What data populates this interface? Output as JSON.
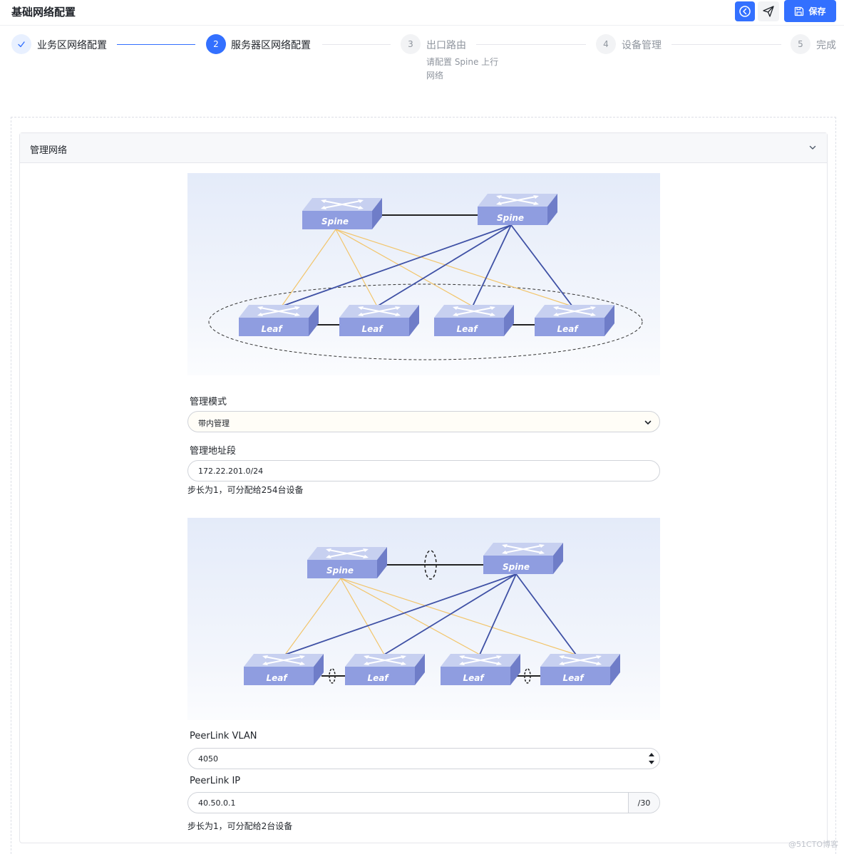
{
  "header": {
    "title": "基础网络配置",
    "save_label": "保存",
    "back_icon": "circle-arrow-left-icon",
    "send_icon": "send-icon",
    "save_icon": "floppy-disk-icon",
    "accent": "#3370ff"
  },
  "steps": [
    {
      "index": "✓",
      "label": "业务区网络配置",
      "status": "done"
    },
    {
      "index": "2",
      "label": "服务器区网络配置",
      "status": "active"
    },
    {
      "index": "3",
      "label": "出口路由",
      "status": "wait",
      "desc": "请配置 Spine 上行网络"
    },
    {
      "index": "4",
      "label": "设备管理",
      "status": "wait"
    },
    {
      "index": "5",
      "label": "完成",
      "status": "wait"
    }
  ],
  "panel": {
    "title": "管理网络",
    "chevron_icon": "chevron-down-icon"
  },
  "diagram1": {
    "spines": [
      "Spine",
      "Spine"
    ],
    "leaves": [
      "Leaf",
      "Leaf",
      "Leaf",
      "Leaf"
    ]
  },
  "mgmt_mode": {
    "label": "管理模式",
    "value": "带内管理"
  },
  "mgmt_addr": {
    "label": "管理地址段",
    "value": "172.22.201.0/24",
    "hint": "步长为1，可分配给254台设备"
  },
  "diagram2": {
    "spines": [
      "Spine",
      "Spine"
    ],
    "leaves": [
      "Leaf",
      "Leaf",
      "Leaf",
      "Leaf"
    ]
  },
  "peerlink_vlan": {
    "label": "PeerLink VLAN",
    "value": "4050"
  },
  "peerlink_ip": {
    "label": "PeerLink IP",
    "value": "40.50.0.1",
    "suffix": "/30",
    "hint": "步长为1，可分配给2台设备"
  },
  "watermark": "@51CTO博客"
}
